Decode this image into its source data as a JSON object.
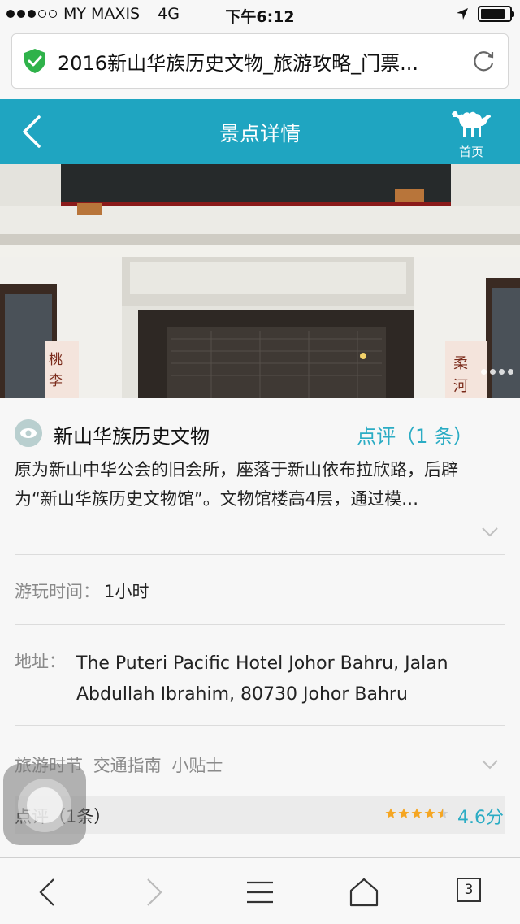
{
  "status_bar": {
    "carrier": "MY MAXIS",
    "network": "4G",
    "time": "下午6:12",
    "signal_bars_filled": 3,
    "signal_bars_total": 5,
    "battery_level": 0.85
  },
  "browser": {
    "url_title": "2016新山华族历史文物_旅游攻略_门票...",
    "secure_icon": "shield-check-icon",
    "reload_icon": "reload-icon",
    "tab_count": "3"
  },
  "header": {
    "title": "景点详情",
    "home_label": "首页",
    "background_color": "#1fa5c1"
  },
  "poi": {
    "name": "新山华族历史文物",
    "review_link": "点评（1 条）",
    "description": "原为新山中华公会的旧会所，座落于新山依布拉欣路，后辟为“新山华族历史文物馆”。文物馆楼高4层，通过模…",
    "play_time_label": "游玩时间：",
    "play_time_value": "1小时",
    "address_label": "地址：",
    "address_value": "The Puteri Pacific Hotel Johor Bahru, Jalan Abdullah Ibrahim, 80730 Johor Bahru",
    "tips": [
      "旅游时节",
      "交通指南",
      "小贴士"
    ]
  },
  "reviews": {
    "label": "点评（1条）",
    "rating_stars": 4.5,
    "score": "4.6分",
    "accent_color": "#2bacc4",
    "star_color": "#f5a623"
  },
  "photo": {
    "sign_left": "桃李",
    "sign_right": "柔河"
  }
}
